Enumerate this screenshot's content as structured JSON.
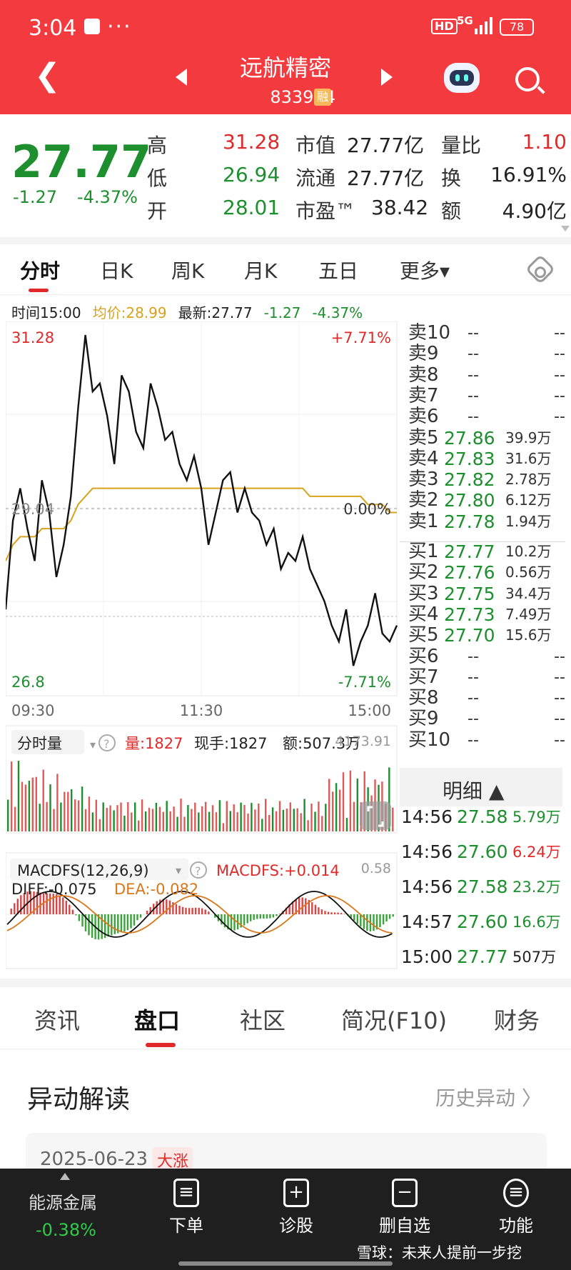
{
  "status_bar": {
    "time": "3:04",
    "dots": "···",
    "hd": "HD",
    "network": "5G",
    "battery": "78"
  },
  "header": {
    "name": "远航精密",
    "code": "833914",
    "badge": "融"
  },
  "quote": {
    "price": "27.77",
    "change": "-1.27",
    "change_pct": "-4.37%",
    "rows": [
      {
        "l1": "高",
        "v1": "31.28",
        "l2": "市值",
        "v2": "27.77亿",
        "l3": "量比",
        "v3": "1.10"
      },
      {
        "l1": "低",
        "v1": "26.94",
        "l2": "流通",
        "v2": "27.77亿",
        "l3": "换",
        "v3": "16.91%"
      },
      {
        "l1": "开",
        "v1": "28.01",
        "l2": "市盈™",
        "v2": "38.42",
        "l3": "额",
        "v3": "4.90亿"
      }
    ]
  },
  "kline_tabs": [
    "分时",
    "日K",
    "周K",
    "月K",
    "五日",
    "更多▾"
  ],
  "info": {
    "time": "时间15:00",
    "avg": "均价:28.99",
    "latest": "最新:27.77",
    "chg": "-1.27",
    "pct": "-4.37%"
  },
  "chart_data": {
    "type": "line",
    "title": "",
    "y_max": 31.28,
    "y_min": 26.8,
    "y_prev_close": 29.04,
    "y_max_pct": "+7.71%",
    "y_min_pct": "-7.71%",
    "y_mid_pct": "0.00%",
    "x_ticks": [
      "09:30",
      "11:30",
      "15:00"
    ],
    "series": [
      {
        "name": "最新",
        "color": "#111111",
        "values": [
          27.8,
          28.9,
          29.3,
          28.8,
          28.4,
          29.4,
          29.0,
          28.2,
          28.6,
          29.2,
          30.3,
          31.2,
          30.5,
          30.6,
          30.2,
          29.6,
          30.7,
          30.5,
          30.0,
          29.8,
          30.6,
          30.3,
          29.9,
          30.0,
          29.6,
          29.4,
          29.7,
          29.3,
          28.6,
          29.0,
          29.4,
          29.5,
          29.0,
          29.3,
          29.0,
          28.9,
          28.6,
          28.8,
          28.3,
          28.5,
          28.4,
          28.7,
          28.3,
          28.1,
          27.9,
          27.6,
          27.4,
          27.8,
          27.1,
          27.4,
          27.6,
          28.0,
          27.5,
          27.4,
          27.6
        ]
      },
      {
        "name": "均价",
        "color": "#d9a21b",
        "values": [
          28.4,
          28.6,
          28.7,
          28.7,
          28.7,
          28.8,
          28.8,
          28.8,
          28.8,
          28.9,
          29.1,
          29.2,
          29.3,
          29.3,
          29.3,
          29.3,
          29.3,
          29.3,
          29.3,
          29.3,
          29.3,
          29.3,
          29.3,
          29.3,
          29.3,
          29.3,
          29.3,
          29.3,
          29.3,
          29.3,
          29.3,
          29.3,
          29.3,
          29.3,
          29.3,
          29.3,
          29.3,
          29.3,
          29.3,
          29.3,
          29.3,
          29.3,
          29.2,
          29.2,
          29.2,
          29.2,
          29.2,
          29.2,
          29.2,
          29.2,
          29.1,
          29.1,
          29.1,
          29.0,
          29.0
        ]
      }
    ]
  },
  "order_book": {
    "asks": [
      {
        "label": "卖10",
        "price": "--",
        "vol": "--"
      },
      {
        "label": "卖9",
        "price": "--",
        "vol": "--"
      },
      {
        "label": "卖8",
        "price": "--",
        "vol": "--"
      },
      {
        "label": "卖7",
        "price": "--",
        "vol": "--"
      },
      {
        "label": "卖6",
        "price": "--",
        "vol": "--"
      },
      {
        "label": "卖5",
        "price": "27.86",
        "vol": "39.9万"
      },
      {
        "label": "卖4",
        "price": "27.83",
        "vol": "31.6万"
      },
      {
        "label": "卖3",
        "price": "27.82",
        "vol": "2.78万"
      },
      {
        "label": "卖2",
        "price": "27.80",
        "vol": "6.12万"
      },
      {
        "label": "卖1",
        "price": "27.78",
        "vol": "1.94万"
      }
    ],
    "bids": [
      {
        "label": "买1",
        "price": "27.77",
        "vol": "10.2万"
      },
      {
        "label": "买2",
        "price": "27.76",
        "vol": "0.56万"
      },
      {
        "label": "买3",
        "price": "27.75",
        "vol": "34.4万"
      },
      {
        "label": "买4",
        "price": "27.73",
        "vol": "7.49万"
      },
      {
        "label": "买5",
        "price": "27.70",
        "vol": "15.6万"
      },
      {
        "label": "买6",
        "price": "--",
        "vol": "--"
      },
      {
        "label": "买7",
        "price": "--",
        "vol": "--"
      },
      {
        "label": "买8",
        "price": "--",
        "vol": "--"
      },
      {
        "label": "买9",
        "price": "--",
        "vol": "--"
      },
      {
        "label": "买10",
        "price": "--",
        "vol": "--"
      }
    ]
  },
  "volume": {
    "selector": "分时量",
    "vol": "量:1827",
    "hand": "现手:1827",
    "amount": "额:507.3万",
    "max_label": "4173.91"
  },
  "macd": {
    "selector": "MACDFS(12,26,9)",
    "value": "MACDFS:+0.014",
    "max_label": "0.58",
    "diff": "DIFF:-0.075",
    "dea": "DEA:-0.082"
  },
  "details": {
    "title": "明细 ▲",
    "rows": [
      {
        "time": "14:56",
        "price": "27.58",
        "vol": "5.79万"
      },
      {
        "time": "14:56",
        "price": "27.60",
        "vol": "6.24万"
      },
      {
        "time": "14:56",
        "price": "27.58",
        "vol": "23.2万"
      },
      {
        "time": "14:57",
        "price": "27.60",
        "vol": "16.6万"
      },
      {
        "time": "15:00",
        "price": "27.77",
        "vol": "507万"
      }
    ]
  },
  "bottom_tabs": [
    "资讯",
    "盘口",
    "社区",
    "简况(F10)",
    "财务"
  ],
  "section": {
    "title": "异动解读",
    "history": "历史异动 〉",
    "date": "2025-06-23",
    "badge": "大涨"
  },
  "bottom_bar": {
    "sector": "能源金属",
    "sector_change": "-0.38%",
    "order": "下单",
    "diagnose": "诊股",
    "remove": "删自选",
    "functions": "功能"
  },
  "watermark": "雪球：未来人提前一步挖",
  "colors": {
    "header": "#f23a3f",
    "up": "#e02a2a",
    "down": "#1d8f2e",
    "avg": "#d9a21b"
  }
}
